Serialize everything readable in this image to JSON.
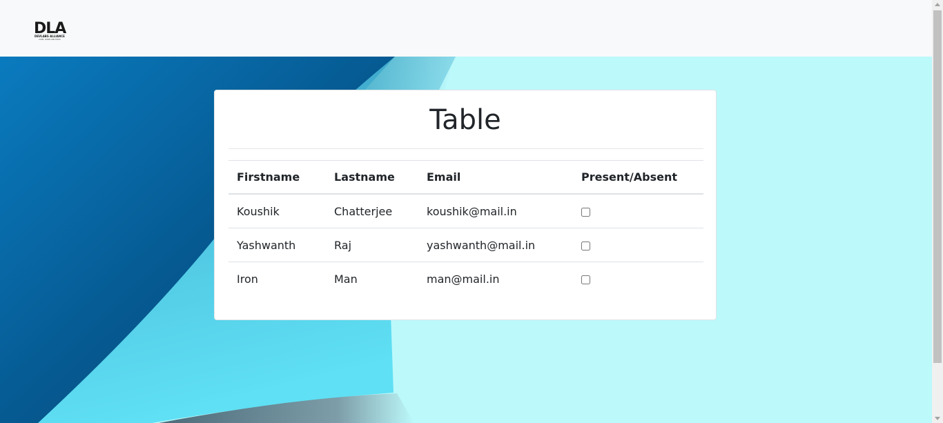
{
  "navbar": {
    "logo": {
      "text": "DLA",
      "subtitle": "DEVLABS ALLIANCE",
      "tagline": "CODE, LEARN AND EXCEL"
    }
  },
  "card": {
    "title": "Table",
    "table": {
      "headers": [
        "Firstname",
        "Lastname",
        "Email",
        "Present/Absent"
      ],
      "rows": [
        {
          "firstname": "Koushik",
          "lastname": "Chatterjee",
          "email": "koushik@mail.in",
          "present": false
        },
        {
          "firstname": "Yashwanth",
          "lastname": "Raj",
          "email": "yashwanth@mail.in",
          "present": false
        },
        {
          "firstname": "Iron",
          "lastname": "Man",
          "email": "man@mail.in",
          "present": false
        }
      ]
    }
  },
  "colors": {
    "background_light": "#bcf9fb",
    "background_dark": "#0a6aa8",
    "card": "#ffffff",
    "text": "#212529"
  }
}
